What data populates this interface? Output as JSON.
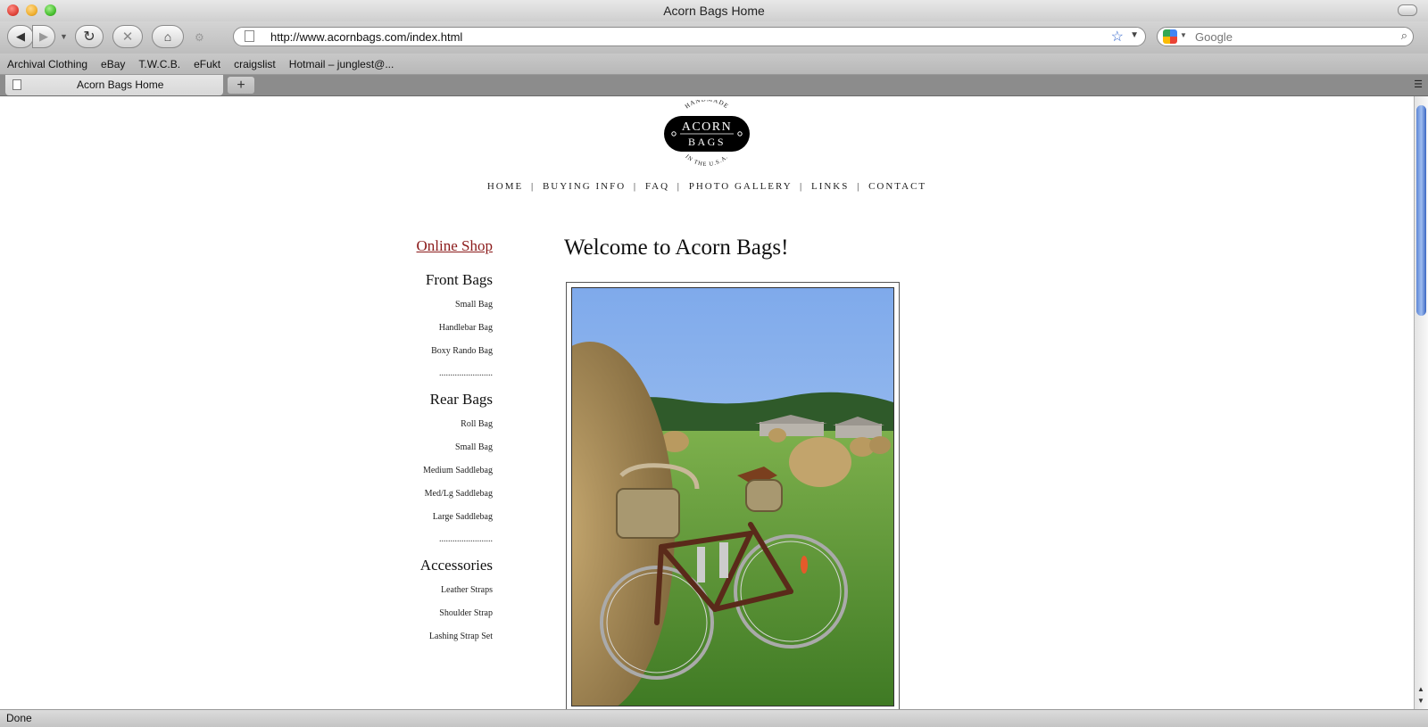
{
  "window": {
    "title": "Acorn Bags Home"
  },
  "toolbar": {
    "url": "http://www.acornbags.com/index.html",
    "search_placeholder": "Google"
  },
  "bookmarks": [
    "Archival Clothing",
    "eBay",
    "T.W.C.B.",
    "eFukt",
    "craigslist",
    "Hotmail – junglest@..."
  ],
  "tabs": [
    {
      "title": "Acorn Bags Home"
    }
  ],
  "page": {
    "logo": {
      "top_text": "HANDMADE",
      "line1": "ACORN",
      "line2": "BAGS",
      "bottom_text": "IN THE U.S.A."
    },
    "nav": [
      "HOME",
      "BUYING INFO",
      "FAQ",
      "PHOTO GALLERY",
      "LINKS",
      "CONTACT"
    ],
    "nav_separator": "|",
    "sidebar": {
      "online_shop": "Online Shop",
      "dots": "........................",
      "front_heading": "Front Bags",
      "front_items": [
        "Small Bag",
        "Handlebar Bag",
        "Boxy Rando Bag"
      ],
      "rear_heading": "Rear Bags",
      "rear_items": [
        "Roll Bag",
        "Small Bag",
        "Medium Saddlebag",
        "Med/Lg Saddlebag",
        "Large Saddlebag"
      ],
      "accessories_heading": "Accessories",
      "accessories_items": [
        "Leather Straps",
        "Shoulder Strap",
        "Lashing Strap Set"
      ]
    },
    "welcome": "Welcome to Acorn Bags!"
  },
  "status": {
    "text": "Done"
  },
  "colors": {
    "link_red": "#8b1a1a",
    "scroll_blue": "#5d86d6",
    "sky": "#8ab4ec",
    "grass": "#4f8f2e"
  }
}
